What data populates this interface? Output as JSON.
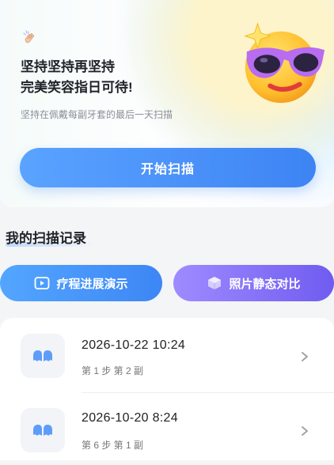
{
  "hero": {
    "title_line1": "坚持坚持再坚持",
    "title_line2": "完美笑容指日可待!",
    "subtitle": "坚持在佩戴每副牙套的最后一天扫描",
    "scan_button": "开始扫描",
    "icons": {
      "clap": "clapping-hands-icon",
      "emoji": "sunglasses-emoji-icon"
    }
  },
  "section": {
    "title": "我的扫描记录"
  },
  "actions": [
    {
      "label": "疗程进展演示",
      "icon": "video-icon",
      "color": "#4a96fb"
    },
    {
      "label": "照片静态对比",
      "icon": "cube-icon",
      "color": "#7e6cf4"
    }
  ],
  "records": [
    {
      "datetime": "2026-10-22  10:24",
      "meta": "第 1 步  第 2 副",
      "icon": "teeth-icon"
    },
    {
      "datetime": "2026-10-20  8:24",
      "meta": "第 6 步  第 1 副",
      "icon": "teeth-icon"
    }
  ],
  "colors": {
    "accent": "#3d84f4",
    "purple": "#6f5cf0",
    "background": "#f4f5f7"
  }
}
